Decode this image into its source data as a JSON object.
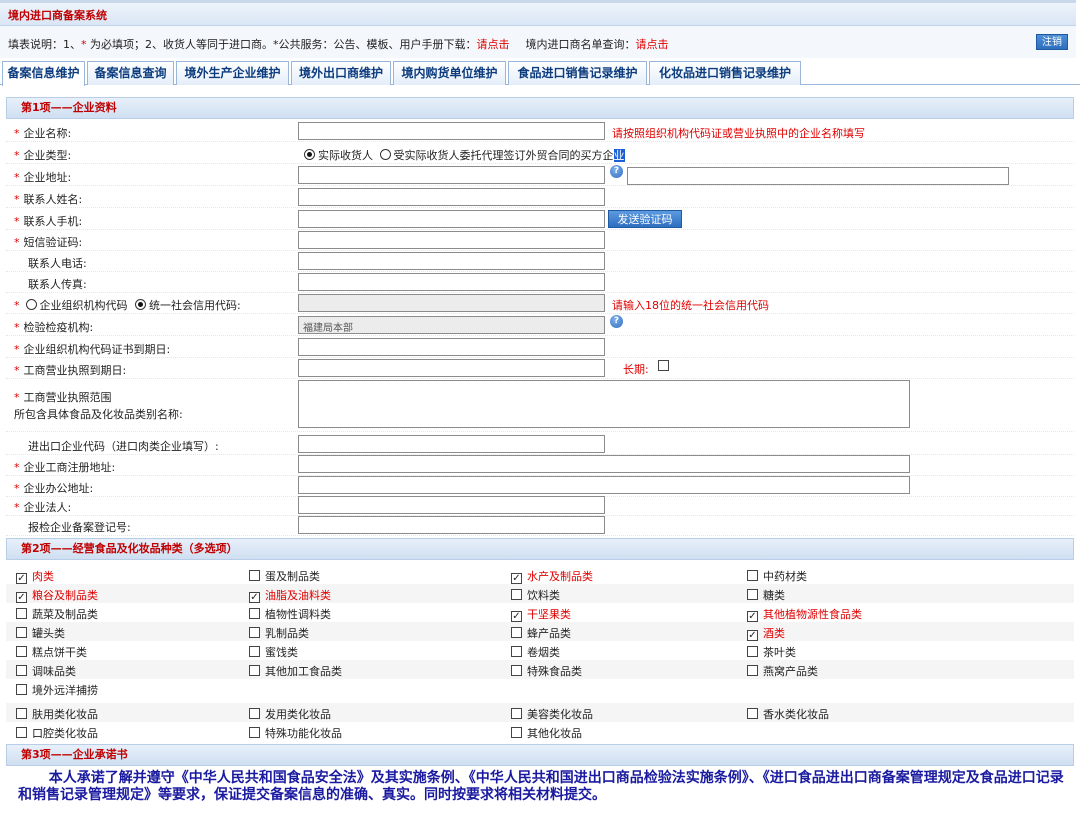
{
  "app_title": "境内进口商备案系统",
  "info": {
    "prefix": "填表说明：1、",
    "star": "*",
    "mid": " 为必填项；2、收货人等同于进口商。*公共服务：公告、模板、用户手册下载：",
    "link1": "请点击",
    "mid2": "境内进口商名单查询：",
    "link2": "请点击"
  },
  "logout_label": "注销",
  "tabs": [
    {
      "label": "备案信息维护"
    },
    {
      "label": "备案信息查询"
    },
    {
      "label": "境外生产企业维护"
    },
    {
      "label": "境外出口商维护"
    },
    {
      "label": "境内购货单位维护"
    },
    {
      "label": "食品进口销售记录维护"
    },
    {
      "label": "化妆品进口销售记录维护"
    }
  ],
  "section1_title": "第1项——企业资料",
  "section2_title": "第2项——经营食品及化妆品种类（多选项）",
  "section3_title": "第3项——企业承诺书",
  "fields": {
    "company_name": "企业名称:",
    "company_name_hint": "请按照组织机构代码证或营业执照中的企业名称填写",
    "company_type": "企业类型:",
    "type_opt1": "实际收货人",
    "type_opt2": "受实际收货人委托代理签订外贸合同的买方企",
    "type_opt2_tail": "业",
    "company_address": "企业地址:",
    "contact_name": "联系人姓名:",
    "contact_mobile": "联系人手机:",
    "send_code_button": "发送验证码",
    "sms_code": "短信验证码:",
    "contact_phone": "联系人电话:",
    "contact_fax": "联系人传真:",
    "org_code_opt": "企业组织机构代码",
    "credit_code_opt": "统一社会信用代码:",
    "credit_code_hint": "请输入18位的统一社会信用代码",
    "inspection_org": "检验检疫机构:",
    "inspection_org_value": "福建局本部",
    "org_code_expiry": "企业组织机构代码证书到期日:",
    "license_expiry": "工商营业执照到期日:",
    "long_term_label": "长期:",
    "scope_label_1": "工商营业执照范围",
    "scope_label_2": "所包含具体食品及化妆品类别名称:",
    "meat_code": "进出口企业代码（进口肉类企业填写）:",
    "reg_address": "企业工商注册地址:",
    "office_address": "企业办公地址:",
    "legal_person": "企业法人:",
    "inspection_reg_no": "报检企业备案登记号:"
  },
  "food_categories": [
    {
      "label": "肉类",
      "checked": true
    },
    {
      "label": "蛋及制品类",
      "checked": false
    },
    {
      "label": "水产及制品类",
      "checked": true
    },
    {
      "label": "中药材类",
      "checked": false
    },
    {
      "label": "粮谷及制品类",
      "checked": true
    },
    {
      "label": "油脂及油料类",
      "checked": true
    },
    {
      "label": "饮料类",
      "checked": false
    },
    {
      "label": "糖类",
      "checked": false
    },
    {
      "label": "蔬菜及制品类",
      "checked": false
    },
    {
      "label": "植物性调料类",
      "checked": false
    },
    {
      "label": "干坚果类",
      "checked": true
    },
    {
      "label": "其他植物源性食品类",
      "checked": true
    },
    {
      "label": "罐头类",
      "checked": false
    },
    {
      "label": "乳制品类",
      "checked": false
    },
    {
      "label": "蜂产品类",
      "checked": false
    },
    {
      "label": "酒类",
      "checked": true
    },
    {
      "label": "糕点饼干类",
      "checked": false
    },
    {
      "label": "蜜饯类",
      "checked": false
    },
    {
      "label": "卷烟类",
      "checked": false
    },
    {
      "label": "茶叶类",
      "checked": false
    },
    {
      "label": "调味品类",
      "checked": false
    },
    {
      "label": "其他加工食品类",
      "checked": false
    },
    {
      "label": "特殊食品类",
      "checked": false
    },
    {
      "label": "燕窝产品类",
      "checked": false
    },
    {
      "label": "境外远洋捕捞",
      "checked": false
    }
  ],
  "cosmetic_categories": [
    {
      "label": "肤用类化妆品",
      "checked": false
    },
    {
      "label": "发用类化妆品",
      "checked": false
    },
    {
      "label": "美容类化妆品",
      "checked": false
    },
    {
      "label": "香水类化妆品",
      "checked": false
    },
    {
      "label": "口腔类化妆品",
      "checked": false
    },
    {
      "label": "特殊功能化妆品",
      "checked": false
    },
    {
      "label": "其他化妆品",
      "checked": false
    }
  ],
  "pledge_text": "本人承诺了解并遵守《中华人民共和国食品安全法》及其实施条例、《中华人民共和国进出口商品检验法实施条例》、《进口食品进出口商备案管理规定及食品进口记录和销售记录管理规定》等要求，保证提交备案信息的准确、真实。同时按要求将相关材料提交。"
}
